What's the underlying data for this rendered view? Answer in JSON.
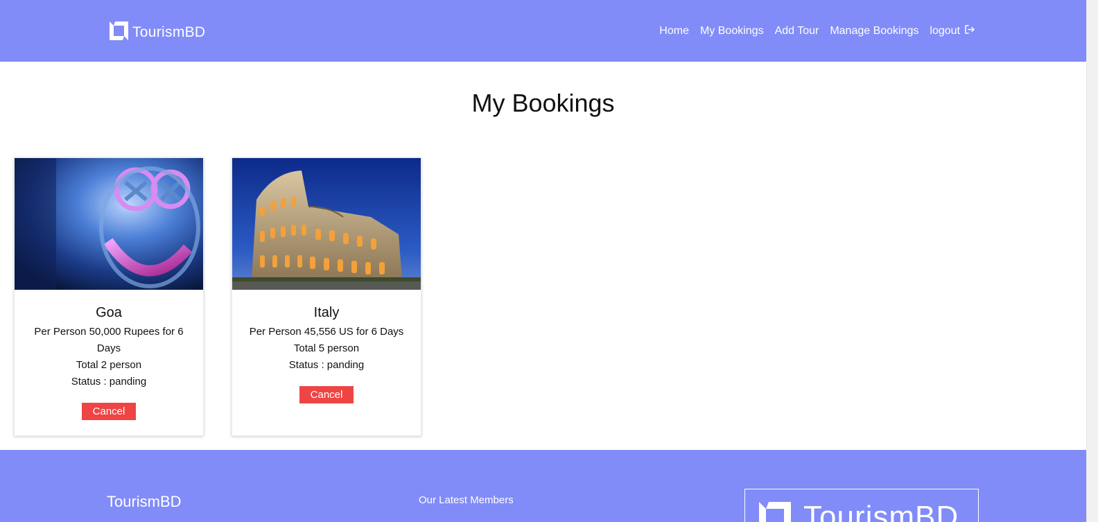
{
  "header": {
    "brand": "TourismBD",
    "nav": {
      "home": "Home",
      "my_bookings": "My Bookings",
      "add_tour": "Add Tour",
      "manage_bookings": "Manage Bookings",
      "logout": "logout"
    }
  },
  "page": {
    "title": "My Bookings"
  },
  "bookings": [
    {
      "title": "Goa",
      "price": "Per Person 50,000 Rupees for 6 Days",
      "total": "Total 2 person",
      "status": "Status : panding",
      "cancel": "Cancel"
    },
    {
      "title": "Italy",
      "price": "Per Person 45,556 US for 6 Days",
      "total": "Total 5 person",
      "status": "Status : panding",
      "cancel": "Cancel"
    }
  ],
  "footer": {
    "brand": "TourismBD",
    "members_heading": "Our Latest Members",
    "logo_text": "TourismBD"
  },
  "icons": {
    "brand": "square-logo-icon",
    "logout": "logout-icon"
  },
  "colors": {
    "primary": "#818cf8",
    "danger": "#ef4444"
  }
}
